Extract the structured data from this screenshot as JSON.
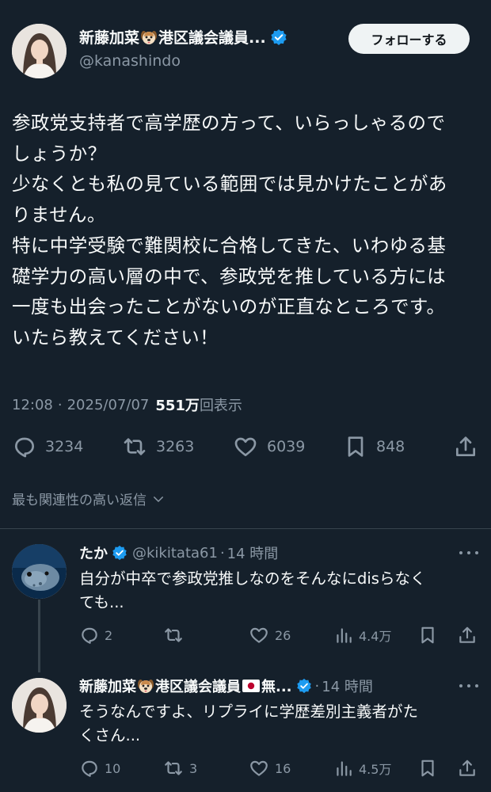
{
  "tweet": {
    "author": {
      "name": "新藤加菜",
      "name_suffix": "港区議会議員...",
      "handle": "@kanashindo",
      "verified": true
    },
    "follow_label": "フォローする",
    "text_lines": [
      "参政党支持者で高学歴の方って、いらっしゃるので",
      "しょうか？",
      "少なくとも私の見ている範囲では見かけたことがあ",
      "りません。",
      "特に中学受験で難関校に合格してきた、いわゆる基",
      "礎学力の高い層の中で、参政党を推している方には",
      "一度も出会ったことがないのが正直なところです。",
      "いたら教えてください！"
    ],
    "meta": {
      "time": "12:08",
      "separator": "·",
      "date": "2025/07/07",
      "views": "551万",
      "views_label": "回表示"
    },
    "stats": {
      "replies": "3234",
      "reposts": "3263",
      "likes": "6039",
      "bookmarks": "848"
    }
  },
  "sort_label": "最も関連性の高い返信",
  "replies": [
    {
      "name": "たか",
      "handle": "@kikitata61",
      "separator": "·",
      "time": "14 時間",
      "text_lines": [
        "自分が中卒で参政党推しなのをそんなにdisらなく",
        "ても..."
      ],
      "stats": {
        "replies": "2",
        "reposts": "",
        "likes": "26",
        "views": "4.4万"
      }
    },
    {
      "name": "新藤加菜",
      "name_suffix": "港区議会議員",
      "name_tail": "無...",
      "handle": "",
      "separator": "·",
      "time": "14 時間",
      "text_lines": [
        "そうなんですよ、リプライに学歴差別主義者がた",
        "くさん..."
      ],
      "stats": {
        "replies": "10",
        "reposts": "3",
        "likes": "16",
        "views": "4.5万"
      }
    }
  ],
  "icons": {
    "dog_emoji": "dog-face-emoji",
    "flag_emoji": "japan-flag-emoji",
    "verified": "verified-badge-icon"
  },
  "colors": {
    "background": "#15202b",
    "text": "#f7f9f9",
    "secondary": "#8b98a5",
    "accent": "#1d9bf0",
    "divider": "#38444d"
  }
}
